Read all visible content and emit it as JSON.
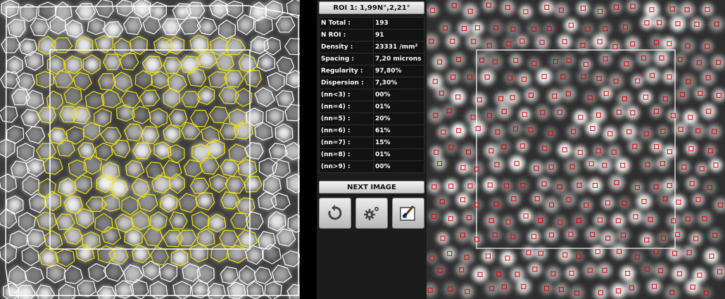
{
  "roi_button": "ROI 1: 1,99N°,2,21°",
  "stats": [
    {
      "label": "N Total :",
      "value": "193"
    },
    {
      "label": "N ROI :",
      "value": "91"
    },
    {
      "label": "Density :",
      "value": "23331 /mm²"
    },
    {
      "label": "Spacing :",
      "value": "7,20 microns"
    },
    {
      "label": "Regularity :",
      "value": "97,80%"
    },
    {
      "label": "Dispersion :",
      "value": "7,30%"
    },
    {
      "label": "(nn<3) :",
      "value": "00%"
    },
    {
      "label": "(nn=4) :",
      "value": "01%"
    },
    {
      "label": "(nn=5) :",
      "value": "20%"
    },
    {
      "label": "(nn=6) :",
      "value": "61%"
    },
    {
      "label": "(nn=7) :",
      "value": "15%"
    },
    {
      "label": "(nn=8) :",
      "value": "01%"
    },
    {
      "label": "(nn>9) :",
      "value": "00%"
    }
  ],
  "next_button": "NEXT IMAGE",
  "icons": [
    "refresh-icon",
    "settings-gears-icon",
    "brush-edit-icon"
  ],
  "colors": {
    "roi_cells": "#f2e600",
    "other_cells": "#ffffff",
    "cell_markers": "#e00000",
    "roi_box": "#ffffff"
  }
}
